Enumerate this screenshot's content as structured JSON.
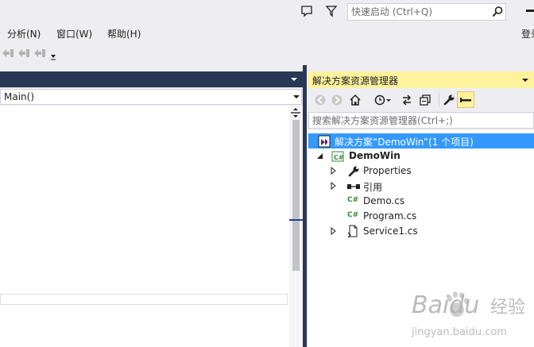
{
  "titlebar": {
    "quick_launch_placeholder": "快速启动 (Ctrl+Q)",
    "icons": [
      "feedback-icon",
      "filter-icon",
      "search-icon",
      "minimize-icon"
    ]
  },
  "menubar": {
    "items": [
      {
        "label": "分析(N)"
      },
      {
        "label": "窗口(W)"
      },
      {
        "label": "帮助(H)"
      },
      {
        "label": "登录"
      }
    ]
  },
  "editor": {
    "member_dropdown": "Main()"
  },
  "solution_explorer": {
    "title": "解决方案资源管理器",
    "search_placeholder": "搜索解决方案资源管理器(Ctrl+;)",
    "tree": [
      {
        "label": "解决方案“DemoWin”(1 个项目)",
        "icon": "solution-icon",
        "selected": true
      },
      {
        "label": "DemoWin",
        "icon": "csharp-project-icon",
        "bold": true
      },
      {
        "label": "Properties",
        "icon": "wrench-icon"
      },
      {
        "label": "引用",
        "icon": "references-icon"
      },
      {
        "label": "Demo.cs",
        "icon": "csharp-file-icon"
      },
      {
        "label": "Program.cs",
        "icon": "csharp-file-icon"
      },
      {
        "label": "Service1.cs",
        "icon": "service-file-icon"
      }
    ]
  },
  "watermark": {
    "brand": "Baidu",
    "brand_cn": "经验",
    "url": "jingyan.baidu.com"
  },
  "colors": {
    "accent": "#3399FF",
    "panel_header_active": "#FFF29D",
    "dark_header": "#293955",
    "chrome": "#EEEEF2"
  }
}
